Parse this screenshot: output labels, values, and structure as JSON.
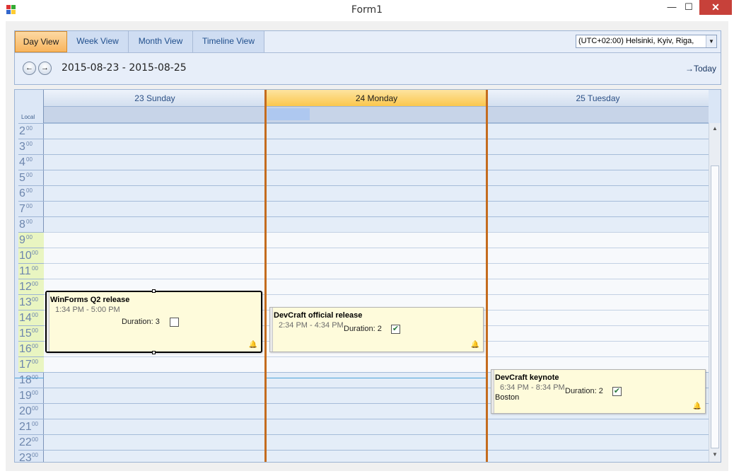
{
  "window": {
    "title": "Form1",
    "minimize": "—",
    "maximize": "☐",
    "close": "✕"
  },
  "header": {
    "tabs": [
      {
        "label": "Day View",
        "active": true
      },
      {
        "label": "Week View",
        "active": false
      },
      {
        "label": "Month View",
        "active": false
      },
      {
        "label": "Timeline View",
        "active": false
      }
    ],
    "timezone": "(UTC+02:00) Helsinki, Kyiv, Riga,",
    "nav_prev": "←",
    "nav_next": "→",
    "date_range": "2015-08-23 - 2015-08-25",
    "today_label": "→Today"
  },
  "ruler": {
    "local_label": "Local",
    "hours": [
      "2",
      "3",
      "4",
      "5",
      "6",
      "7",
      "8",
      "9",
      "10",
      "11",
      "12",
      "13",
      "14",
      "15",
      "16",
      "17",
      "18",
      "19",
      "20",
      "21",
      "22",
      "23"
    ],
    "minutes": "00",
    "work_start": "9",
    "work_end": "17"
  },
  "days": [
    {
      "label": "23 Sunday",
      "today": false
    },
    {
      "label": "24 Monday",
      "today": true
    },
    {
      "label": "25 Tuesday",
      "today": false
    }
  ],
  "appointments": [
    {
      "subject": "WinForms Q2 release",
      "time": "1:34 PM - 5:00 PM",
      "duration_label": "Duration: 3",
      "checked": false,
      "location": "",
      "reminder": true,
      "selected": true
    },
    {
      "subject": "DevCraft official release",
      "time": "2:34 PM - 4:34 PM",
      "duration_label": "Duration: 2",
      "checked": true,
      "location": "",
      "reminder": true,
      "selected": false
    },
    {
      "subject": "DevCraft keynote",
      "time": "6:34 PM - 8:34 PM",
      "duration_label": "Duration: 2",
      "checked": true,
      "location": "Boston",
      "reminder": true,
      "selected": false
    }
  ],
  "icons": {
    "checkmark": "✔",
    "bell": "🔔",
    "scroll_up": "▲",
    "scroll_down": "▼",
    "dropdown": "▼"
  },
  "colors": {
    "today_header": "#fbc74d",
    "today_border": "#c46c1e",
    "work_hours": "#e9f5c1",
    "appointment_bg": "#fefbdb"
  }
}
